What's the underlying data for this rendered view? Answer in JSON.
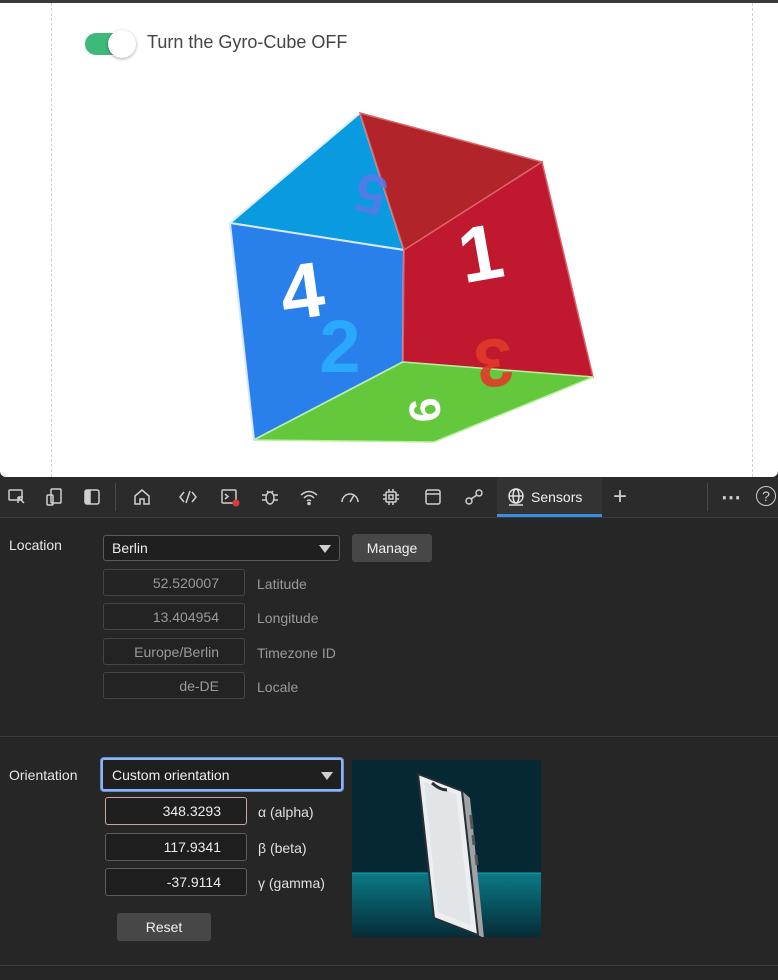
{
  "page": {
    "toggle_label": "Turn the Gyro-Cube OFF",
    "toggle_on": true,
    "cube_face_numbers": [
      "1",
      "2",
      "3",
      "4",
      "5",
      "6"
    ]
  },
  "toolbar": {
    "icons": [
      "inspect-icon",
      "device-emulation-icon",
      "dock-panel-icon",
      "home-icon",
      "elements-icon",
      "console-icon",
      "sources-icon",
      "network-icon",
      "performance-icon",
      "memory-icon",
      "application-icon",
      "connections-icon",
      "sensors-globe-icon",
      "add-tab-icon",
      "more-icon",
      "help-icon"
    ],
    "active_tab": "Sensors",
    "add_tab": "+",
    "more": "⋯",
    "help": "?"
  },
  "location": {
    "label": "Location",
    "selected": "Berlin",
    "manage_label": "Manage",
    "fields": [
      {
        "value": "52.520007",
        "label": "Latitude"
      },
      {
        "value": "13.404954",
        "label": "Longitude"
      },
      {
        "value": "Europe/Berlin",
        "label": "Timezone ID"
      },
      {
        "value": "de-DE",
        "label": "Locale"
      }
    ]
  },
  "orientation": {
    "label": "Orientation",
    "selected": "Custom orientation",
    "alpha": {
      "value": "348.3293",
      "label": "α (alpha)"
    },
    "beta": {
      "value": "117.9341",
      "label": "β (beta)"
    },
    "gamma": {
      "value": "-37.9114",
      "label": "γ (gamma)"
    },
    "reset_label": "Reset"
  },
  "colors": {
    "toggle_on": "#3fb97a",
    "face_top": "#0a9adf",
    "face_left": "#2a80ea",
    "face_right": "#c0182f",
    "face_bottom": "#63c83c",
    "accent": "#3a8ee6"
  }
}
